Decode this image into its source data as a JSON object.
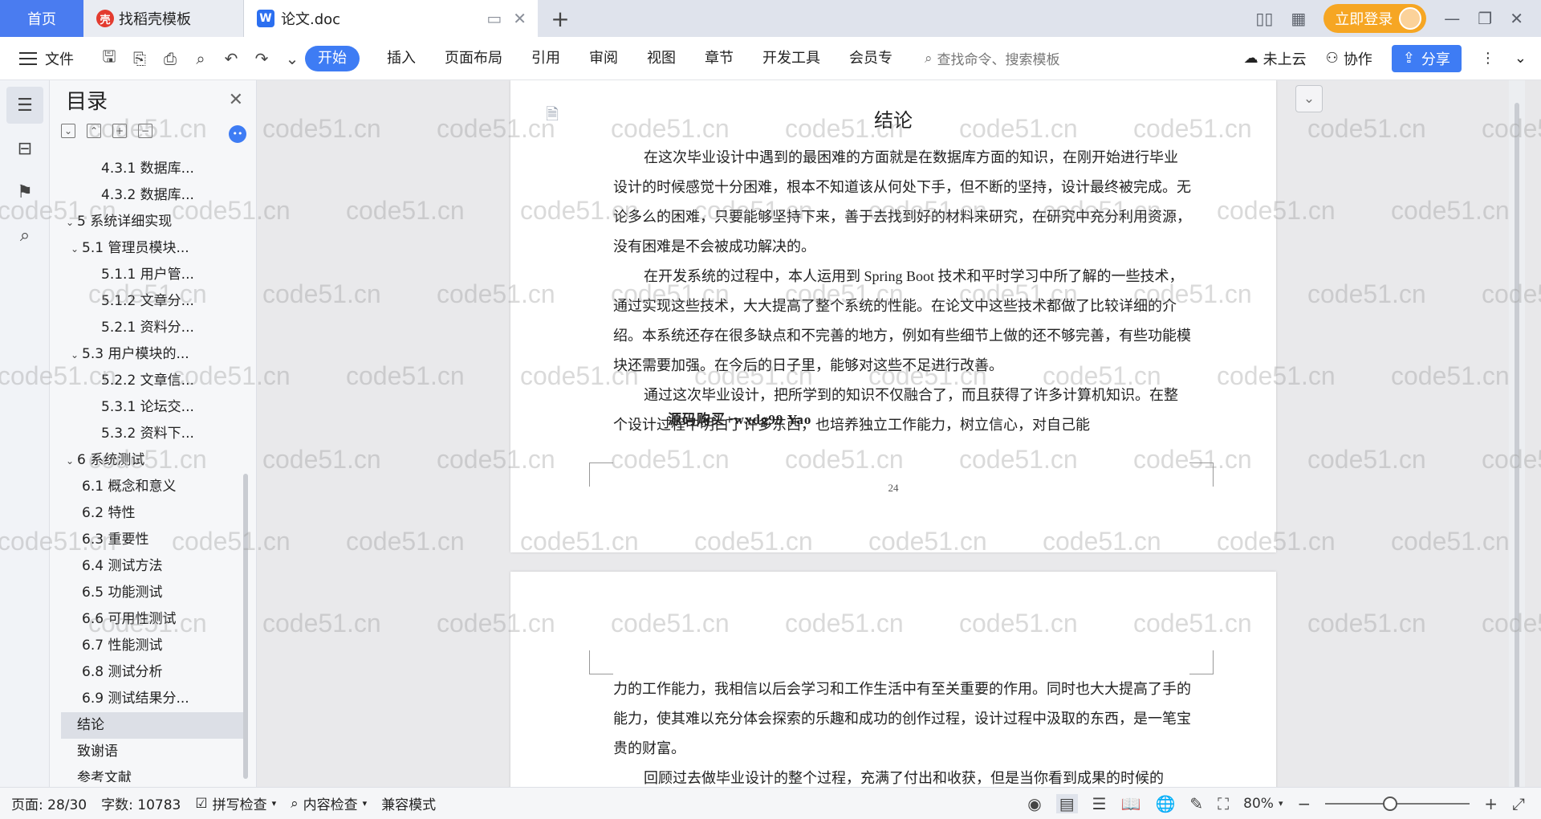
{
  "tabs": {
    "home": "首页",
    "tab1": "找稻壳模板",
    "tab2": "论文.doc",
    "login": "立即登录"
  },
  "ribbon": {
    "file": "文件",
    "menu": [
      "开始",
      "插入",
      "页面布局",
      "引用",
      "审阅",
      "视图",
      "章节",
      "开发工具",
      "会员专"
    ],
    "search_placeholder": "查找命令、搜索模板",
    "cloud": "未上云",
    "collab": "协作",
    "share": "分享"
  },
  "toc": {
    "title": "目录",
    "items": [
      {
        "label": "4.3.1 数据库...",
        "level": 3
      },
      {
        "label": "4.3.2 数据库...",
        "level": 3
      },
      {
        "label": "5 系统详细实现",
        "level": 1,
        "expanded": true
      },
      {
        "label": "5.1 管理员模块...",
        "level": 2,
        "expanded": true
      },
      {
        "label": "5.1.1 用户管...",
        "level": 3
      },
      {
        "label": "5.1.2 文章分...",
        "level": 3
      },
      {
        "label": "5.2.1 资料分...",
        "level": 3
      },
      {
        "label": "5.3 用户模块的...",
        "level": 2,
        "expanded": true
      },
      {
        "label": "5.2.2 文章信...",
        "level": 3
      },
      {
        "label": "5.3.1 论坛交...",
        "level": 3
      },
      {
        "label": "5.3.2 资料下...",
        "level": 3
      },
      {
        "label": "6 系统测试",
        "level": 1,
        "expanded": true
      },
      {
        "label": "6.1 概念和意义",
        "level": 2
      },
      {
        "label": "6.2 特性",
        "level": 2
      },
      {
        "label": "6.3 重要性",
        "level": 2
      },
      {
        "label": "6.4 测试方法",
        "level": 2
      },
      {
        "label": "6.5 功能测试",
        "level": 2
      },
      {
        "label": "6.6 可用性测试",
        "level": 2
      },
      {
        "label": "6.7 性能测试",
        "level": 2
      },
      {
        "label": "6.8 测试分析",
        "level": 2
      },
      {
        "label": "6.9 测试结果分...",
        "level": 2
      },
      {
        "label": "结论",
        "level": 1,
        "active": true
      },
      {
        "label": "致谢语",
        "level": 1
      },
      {
        "label": "参考文献",
        "level": 1
      }
    ]
  },
  "document": {
    "page1": {
      "heading": "结论",
      "paragraphs": [
        "在这次毕业设计中遇到的最困难的方面就是在数据库方面的知识，在刚开始进行毕业设计的时候感觉十分困难，根本不知道该从何处下手，但不断的坚持，设计最终被完成。无论多么的困难，只要能够坚持下来，善于去找到好的材料来研究，在研究中充分利用资源，没有困难是不会被成功解决的。",
        "在开发系统的过程中，本人运用到 Spring Boot 技术和平时学习中所了解的一些技术，通过实现这些技术，大大提高了整个系统的性能。在论文中这些技术都做了比较详细的介绍。本系统还存在很多缺点和不完善的地方，例如有些细节上做的还不够完善，有些功能模块还需要加强。在今后的日子里，能够对这些不足进行改善。",
        "通过这次毕业设计，把所学到的知识不仅融合了，而且获得了许多计算机知识。在整个设计过程中明白了许多东西，也培养独立工作能力，树立信心，对自己能"
      ],
      "overlay_text": "源码购买+wxdg99 Yao",
      "page_number": "24"
    },
    "page2": {
      "paragraphs": [
        "力的工作能力，我相信以后会学习和工作生活中有至关重要的作用。同时也大大提高了手的能力，使其难以充分体会探索的乐趣和成功的创作过程，设计过程中汲取的东西，是一笔宝贵的财富。",
        "回顾过去做毕业设计的整个过程，充满了付出和收获，但是当你看到成果的时候的"
      ]
    },
    "watermark": "code51.cn"
  },
  "status": {
    "page": "页面: 28/30",
    "words": "字数: 10783",
    "spell": "拼写检查",
    "content": "内容检查",
    "compat": "兼容模式",
    "zoom": "80%",
    "zoom_level": 0.45
  }
}
